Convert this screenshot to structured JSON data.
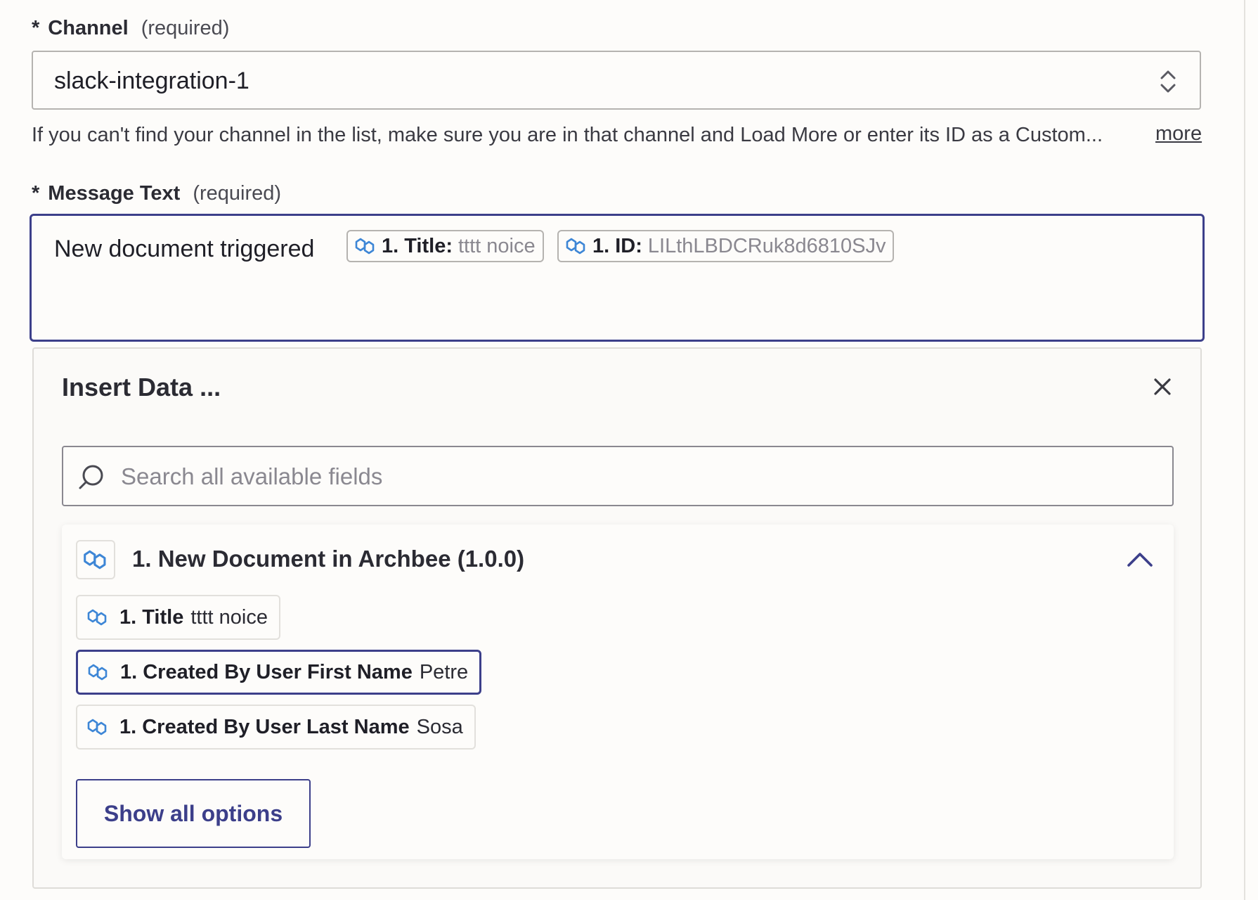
{
  "channel": {
    "star": "*",
    "label": "Channel",
    "required": "(required)",
    "value": "slack-integration-1",
    "helper": "If you can't find your channel in the list, make sure you are in that channel and Load More or enter its ID as a Custom...",
    "more_link": "more"
  },
  "message": {
    "star": "*",
    "label": "Message Text",
    "required": "(required)",
    "text": "New document triggered",
    "pills": [
      {
        "key": "1. Title:",
        "value": "tttt noice",
        "icon": "archbee-hex-icon"
      },
      {
        "key": "1. ID:",
        "value": "LILthLBDCRuk8d6810SJv",
        "icon": "archbee-hex-icon"
      }
    ]
  },
  "insert_panel": {
    "title": "Insert Data ...",
    "close_icon": "close-icon",
    "search_placeholder": "Search all available fields",
    "group": {
      "title": "1. New Document in Archbee (1.0.0)",
      "expanded": true,
      "options": [
        {
          "key": "1. Title",
          "value": "tttt noice",
          "selected": false
        },
        {
          "key": "1. Created By User First Name",
          "value": "Petre",
          "selected": true
        },
        {
          "key": "1. Created By User Last Name",
          "value": "Sosa",
          "selected": false
        }
      ],
      "show_all_label": "Show all options"
    }
  },
  "colors": {
    "accent": "#3c3f8a",
    "icon_blue": "#3d86d6",
    "background": "#fdfcfa"
  }
}
